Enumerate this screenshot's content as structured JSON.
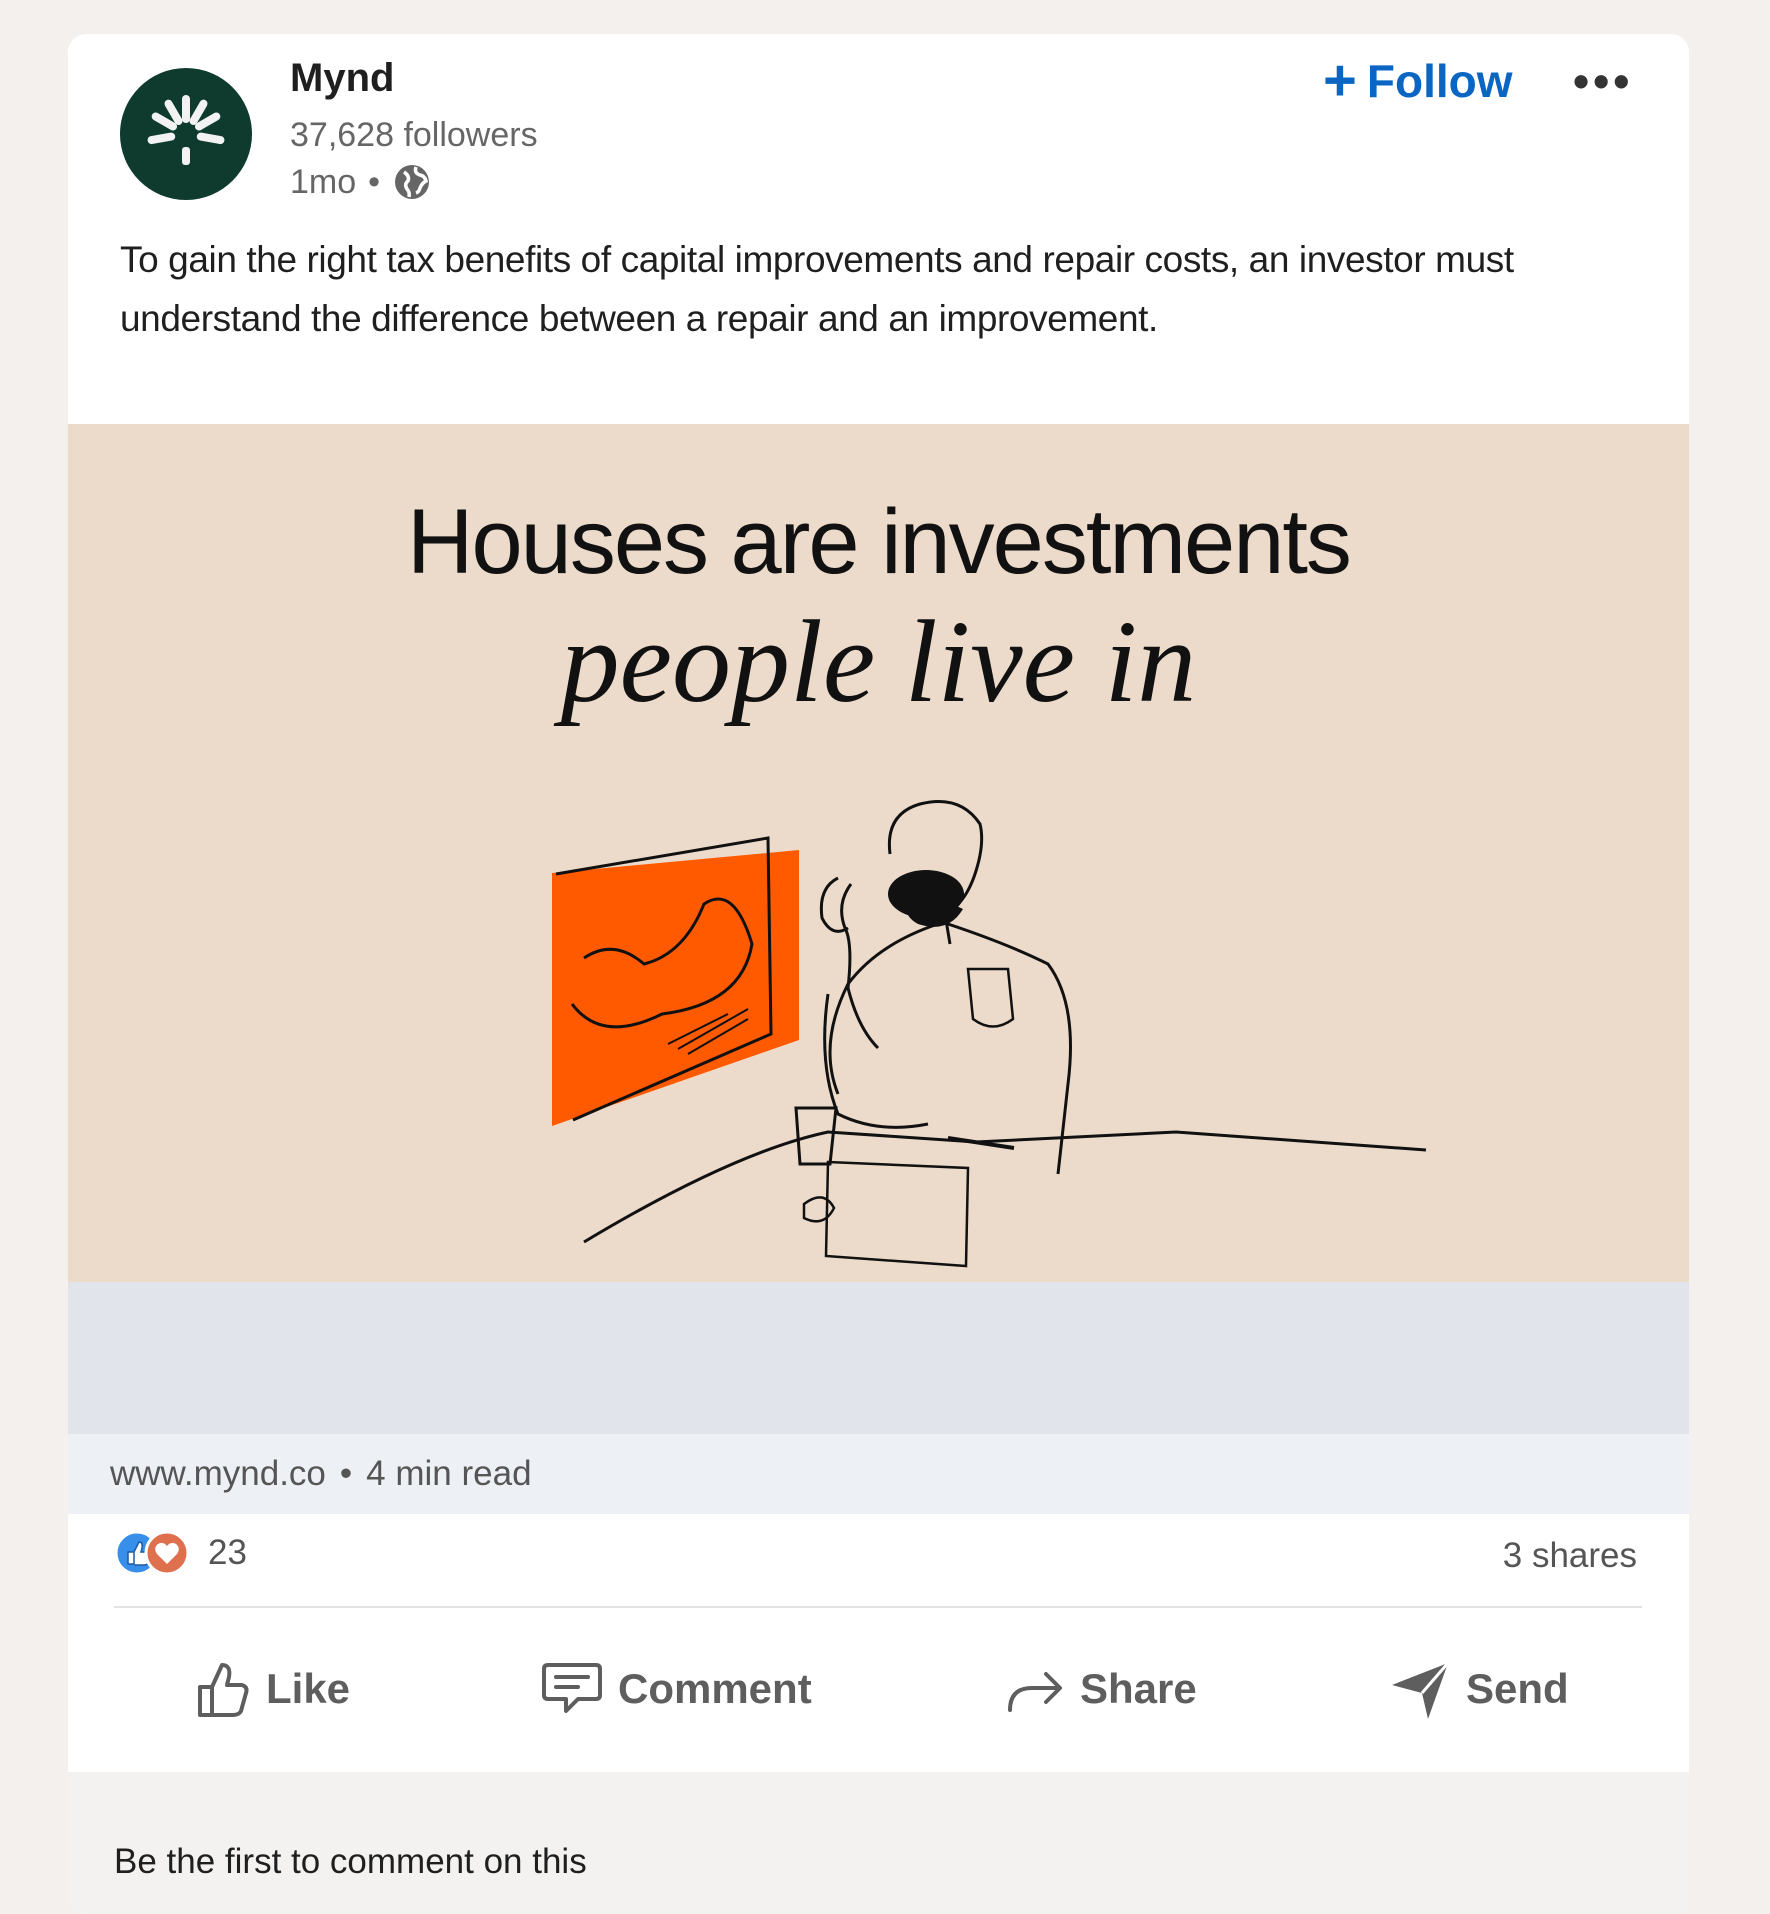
{
  "company": {
    "name": "Mynd",
    "followers": "37,628 followers",
    "age": "1mo",
    "separator": "•"
  },
  "header": {
    "follow_label": "Follow",
    "follow_plus": "+",
    "more_label": "•••"
  },
  "post": {
    "text": "To gain the right tax benefits of capital improvements and repair costs, an investor must understand the difference between a repair and an improvement."
  },
  "hero": {
    "headline": "Houses are investments",
    "subline": "people live in"
  },
  "link": {
    "domain": "www.mynd.co",
    "separator": "•",
    "read_time": "4 min read"
  },
  "social": {
    "reaction_count": "23",
    "shares": "3 shares"
  },
  "actions": {
    "like": "Like",
    "comment": "Comment",
    "share": "Share",
    "send": "Send"
  },
  "comments": {
    "prompt": "Be the first to comment on this"
  },
  "colors": {
    "brand_dark_green": "#0e3b2e",
    "follow_blue": "#0a66c2",
    "hero_bg": "#ecdbcb",
    "accent_orange": "#ff5a00"
  },
  "icons": [
    "mynd-logo-icon",
    "globe-icon",
    "plus-icon",
    "more-icon",
    "like-reaction-icon",
    "love-reaction-icon",
    "like-icon",
    "comment-icon",
    "share-icon",
    "send-icon"
  ]
}
